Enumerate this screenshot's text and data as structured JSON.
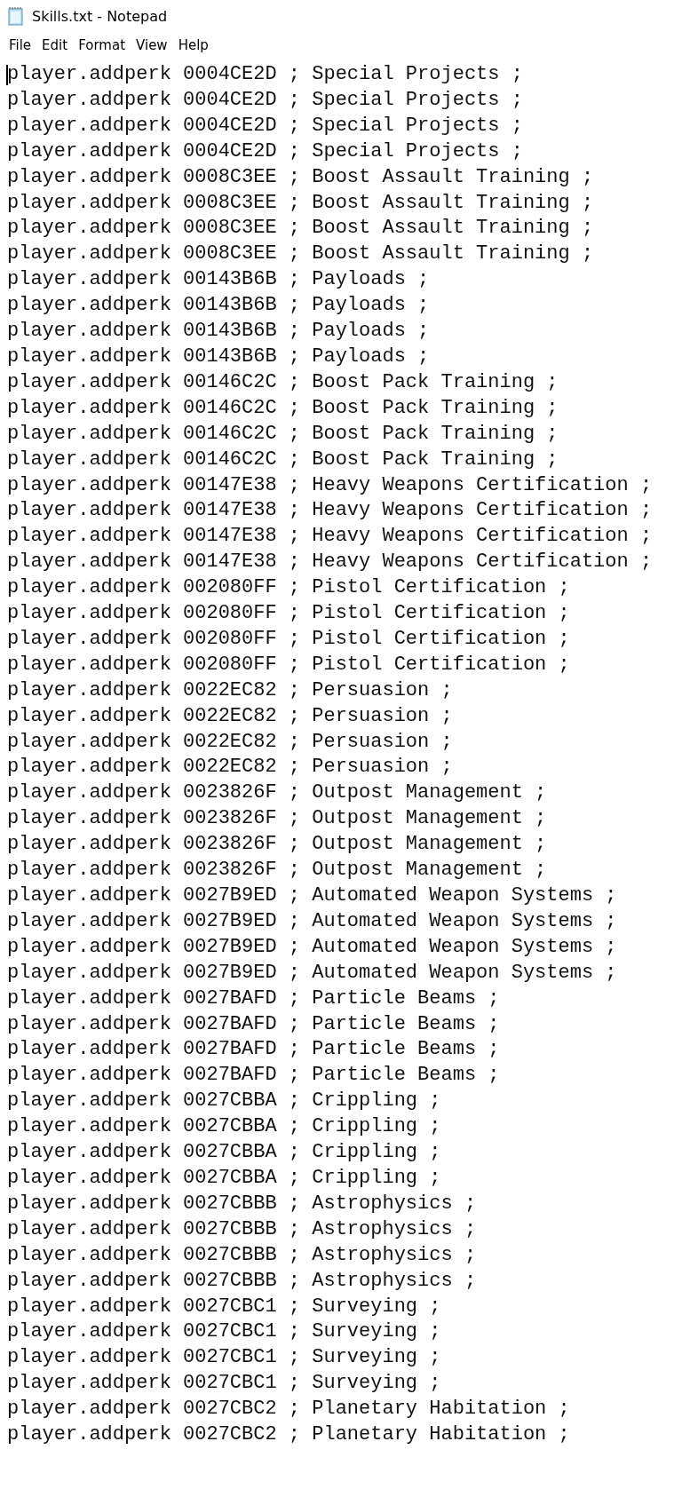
{
  "window": {
    "title": "Skills.txt - Notepad"
  },
  "menu": [
    "File",
    "Edit",
    "Format",
    "View",
    "Help"
  ],
  "lines": [
    "player.addperk 0004CE2D ; Special Projects ;",
    "player.addperk 0004CE2D ; Special Projects ;",
    "player.addperk 0004CE2D ; Special Projects ;",
    "player.addperk 0004CE2D ; Special Projects ;",
    "player.addperk 0008C3EE ; Boost Assault Training ;",
    "player.addperk 0008C3EE ; Boost Assault Training ;",
    "player.addperk 0008C3EE ; Boost Assault Training ;",
    "player.addperk 0008C3EE ; Boost Assault Training ;",
    "player.addperk 00143B6B ; Payloads ;",
    "player.addperk 00143B6B ; Payloads ;",
    "player.addperk 00143B6B ; Payloads ;",
    "player.addperk 00143B6B ; Payloads ;",
    "player.addperk 00146C2C ; Boost Pack Training ;",
    "player.addperk 00146C2C ; Boost Pack Training ;",
    "player.addperk 00146C2C ; Boost Pack Training ;",
    "player.addperk 00146C2C ; Boost Pack Training ;",
    "player.addperk 00147E38 ; Heavy Weapons Certification ;",
    "player.addperk 00147E38 ; Heavy Weapons Certification ;",
    "player.addperk 00147E38 ; Heavy Weapons Certification ;",
    "player.addperk 00147E38 ; Heavy Weapons Certification ;",
    "player.addperk 002080FF ; Pistol Certification ;",
    "player.addperk 002080FF ; Pistol Certification ;",
    "player.addperk 002080FF ; Pistol Certification ;",
    "player.addperk 002080FF ; Pistol Certification ;",
    "player.addperk 0022EC82 ; Persuasion ;",
    "player.addperk 0022EC82 ; Persuasion ;",
    "player.addperk 0022EC82 ; Persuasion ;",
    "player.addperk 0022EC82 ; Persuasion ;",
    "player.addperk 0023826F ; Outpost Management ;",
    "player.addperk 0023826F ; Outpost Management ;",
    "player.addperk 0023826F ; Outpost Management ;",
    "player.addperk 0023826F ; Outpost Management ;",
    "player.addperk 0027B9ED ; Automated Weapon Systems ;",
    "player.addperk 0027B9ED ; Automated Weapon Systems ;",
    "player.addperk 0027B9ED ; Automated Weapon Systems ;",
    "player.addperk 0027B9ED ; Automated Weapon Systems ;",
    "player.addperk 0027BAFD ; Particle Beams ;",
    "player.addperk 0027BAFD ; Particle Beams ;",
    "player.addperk 0027BAFD ; Particle Beams ;",
    "player.addperk 0027BAFD ; Particle Beams ;",
    "player.addperk 0027CBBA ; Crippling ;",
    "player.addperk 0027CBBA ; Crippling ;",
    "player.addperk 0027CBBA ; Crippling ;",
    "player.addperk 0027CBBA ; Crippling ;",
    "player.addperk 0027CBBB ; Astrophysics ;",
    "player.addperk 0027CBBB ; Astrophysics ;",
    "player.addperk 0027CBBB ; Astrophysics ;",
    "player.addperk 0027CBBB ; Astrophysics ;",
    "player.addperk 0027CBC1 ; Surveying ;",
    "player.addperk 0027CBC1 ; Surveying ;",
    "player.addperk 0027CBC1 ; Surveying ;",
    "player.addperk 0027CBC1 ; Surveying ;",
    "player.addperk 0027CBC2 ; Planetary Habitation ;",
    "player.addperk 0027CBC2 ; Planetary Habitation ;"
  ]
}
